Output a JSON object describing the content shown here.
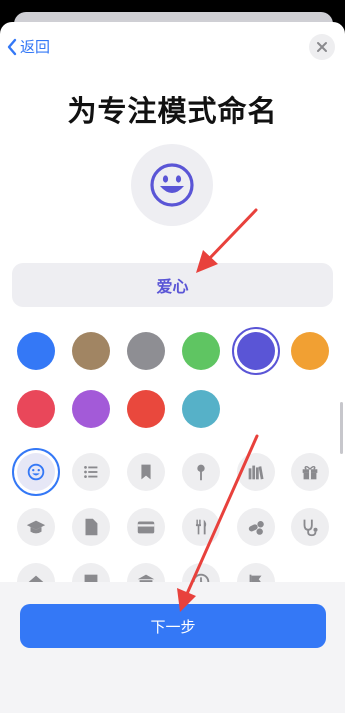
{
  "nav": {
    "back_label": "返回"
  },
  "title": "为专注模式命名",
  "name_field": {
    "value": "爱心"
  },
  "colors": [
    "#3478f6",
    "#a18563",
    "#8e8e93",
    "#5fc562",
    "#5a55d6",
    "#f1a033",
    "#e9475a",
    "#a35ad8",
    "#e9483d",
    "#56b1c8"
  ],
  "selected_color": "#5a55d6",
  "icon_color": "#5a55d6",
  "glyph_icons": [
    "smiley-icon",
    "list-icon",
    "bookmark-icon",
    "pin-icon",
    "books-icon",
    "gift-icon",
    "graduation-cap-icon",
    "document-icon",
    "credit-card-icon",
    "fork-knife-icon",
    "pills-icon",
    "stethoscope-icon",
    "house-icon",
    "building-icon",
    "bank-icon",
    "clock-icon",
    "flag-icon"
  ],
  "selected_glyph": "smiley-icon",
  "footer": {
    "next_label": "下一步"
  }
}
